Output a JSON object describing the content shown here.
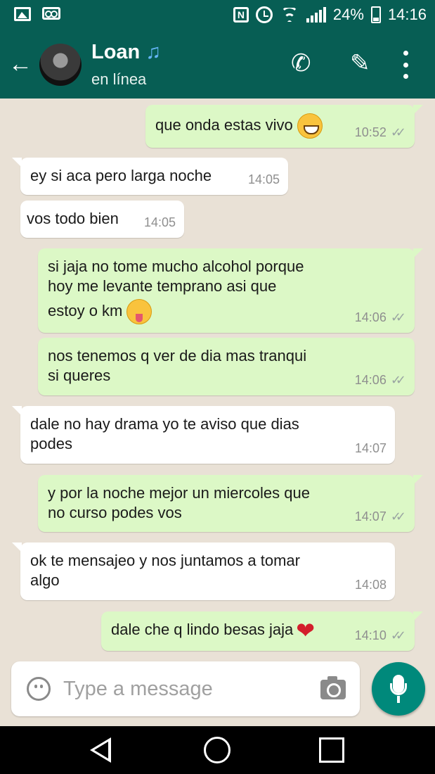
{
  "status_bar": {
    "battery": "24%",
    "time": "14:16",
    "icons": [
      "image-icon",
      "voicemail-icon",
      "nfc-icon",
      "alarm-icon",
      "wifi-icon",
      "signal-icon",
      "battery-icon"
    ]
  },
  "header": {
    "contact_name": "Loan",
    "name_emoji": "♫",
    "status": "en línea",
    "icons": [
      "back-arrow-icon",
      "phone-icon",
      "paperclip-icon",
      "more-vert-icon"
    ]
  },
  "messages": [
    {
      "direction": "out",
      "text": "que onda estas vivo",
      "emoji": "grinning-face",
      "time": "10:52",
      "ticks": "✓✓"
    },
    {
      "direction": "in",
      "text": "ey si aca pero larga noche",
      "time": "14:05"
    },
    {
      "direction": "in",
      "text": "vos todo bien",
      "time": "14:05"
    },
    {
      "direction": "out",
      "text_lines": [
        "si jaja no tome mucho alcohol porque",
        "hoy me levante temprano asi que",
        "estoy o km"
      ],
      "emoji": "winking-tongue-face",
      "time": "14:06",
      "ticks": "✓✓"
    },
    {
      "direction": "out",
      "text_lines": [
        "nos tenemos q ver de dia mas tranqui",
        "si queres"
      ],
      "time": "14:06",
      "ticks": "✓✓"
    },
    {
      "direction": "in",
      "text_lines": [
        "dale no hay drama yo te aviso que dias",
        "podes"
      ],
      "time": "14:07"
    },
    {
      "direction": "out",
      "text_lines": [
        "y por la noche mejor un miercoles que",
        "no curso podes vos"
      ],
      "time": "14:07",
      "ticks": "✓✓"
    },
    {
      "direction": "in",
      "text_lines": [
        "ok te mensajeo y nos juntamos a tomar",
        "algo"
      ],
      "time": "14:08"
    },
    {
      "direction": "out",
      "text": "dale che q lindo besas jaja",
      "emoji": "red-heart",
      "emoji_char": "❤",
      "time": "14:10",
      "ticks": "✓✓"
    }
  ],
  "composer": {
    "placeholder": "Type a message",
    "icons": [
      "emoji-icon",
      "camera-icon",
      "mic-icon"
    ]
  },
  "colors": {
    "header": "#075e54",
    "outgoing_bubble": "#dcf8c6",
    "incoming_bubble": "#ffffff",
    "chat_background": "#e9e1d6",
    "mic_button": "#00897b",
    "note_icon": "#64b5f6"
  }
}
